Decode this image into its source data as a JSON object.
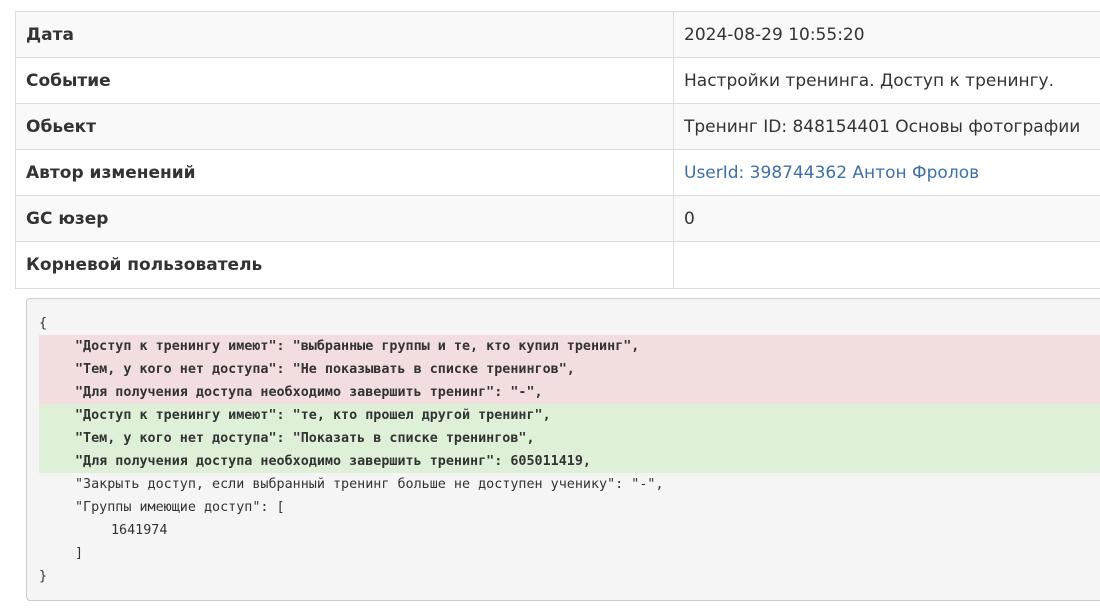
{
  "details": {
    "rows": [
      {
        "label": "Дата",
        "value": "2024-08-29 10:55:20"
      },
      {
        "label": "Событие",
        "value": "Настройки тренинга. Доступ к тренингу."
      },
      {
        "label": "Обьект",
        "value": "Тренинг ID: 848154401 Основы фотографии"
      },
      {
        "label": "Автор изменений",
        "value": "UserId: 398744362 Антон Фролов"
      },
      {
        "label": "GC юзер",
        "value": "0"
      },
      {
        "label": "Корневой пользователь",
        "value": ""
      }
    ]
  },
  "diff": {
    "open_brace": "{",
    "removed": [
      "\"Доступ к тренингу имеют\": \"выбранные группы и те, кто купил тренинг\",",
      "\"Тем, у кого нет доступа\": \"Не показывать в списке тренингов\",",
      "\"Для получения доступа необходимо завершить тренинг\": \"-\","
    ],
    "added": [
      "\"Доступ к тренингу имеют\": \"те, кто прошел другой тренинг\",",
      "\"Тем, у кого нет доступа\": \"Показать в списке тренингов\",",
      "\"Для получения доступа необходимо завершить тренинг\": 605011419,"
    ],
    "unchanged": [
      "\"Закрыть доступ, если выбранный тренинг больше не доступен ученику\": \"-\",",
      "\"Группы имеющие доступ\": ["
    ],
    "group_id": "1641974",
    "close_bracket": "]",
    "close_brace": "}"
  },
  "colors": {
    "removed_bg": "#f2dede",
    "added_bg": "#dff0d8",
    "link": "#3e6fa8"
  }
}
